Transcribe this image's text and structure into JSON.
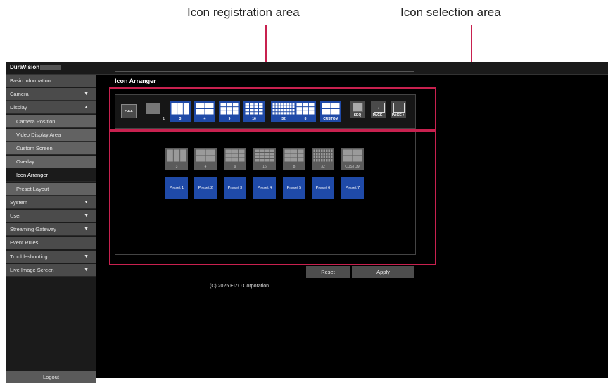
{
  "callouts": {
    "registration": "Icon registration area",
    "selection": "Icon selection area",
    "accent_color": "#c8214f"
  },
  "app": {
    "brand": "DuraVision",
    "page_title": "Icon Arranger",
    "copyright": "(C) 2025 EIZO Corporation"
  },
  "sidebar": {
    "items": [
      {
        "label": "Basic Information",
        "arrow": ""
      },
      {
        "label": "Camera",
        "arrow": "▼"
      },
      {
        "label": "Display",
        "arrow": "▲"
      },
      {
        "label": "Camera Position",
        "arrow": ""
      },
      {
        "label": "Video Display Area",
        "arrow": ""
      },
      {
        "label": "Custom Screen",
        "arrow": ""
      },
      {
        "label": "Overlay",
        "arrow": ""
      },
      {
        "label": "Icon Arranger",
        "arrow": ""
      },
      {
        "label": "Preset Layout",
        "arrow": ""
      },
      {
        "label": "System",
        "arrow": "▼"
      },
      {
        "label": "User",
        "arrow": "▼"
      },
      {
        "label": "Streaming Gateway",
        "arrow": "▼"
      },
      {
        "label": "Event Rules",
        "arrow": ""
      },
      {
        "label": "Troubleshooting",
        "arrow": "▼"
      },
      {
        "label": "Live Image Screen",
        "arrow": "▼"
      }
    ],
    "logout": "Logout"
  },
  "registration_icons": [
    {
      "label": "FULL",
      "name": "full-screen-icon"
    },
    {
      "label": "1",
      "name": "single-view-icon"
    },
    {
      "label": "3",
      "name": "layout-3-icon"
    },
    {
      "label": "4",
      "name": "layout-4-icon"
    },
    {
      "label": "9",
      "name": "layout-9-icon"
    },
    {
      "label": "16",
      "name": "layout-16-icon"
    },
    {
      "label": "32",
      "name": "layout-32-icon"
    },
    {
      "label": "8",
      "name": "layout-8-icon"
    },
    {
      "label": "CUSTOM",
      "name": "layout-custom-icon"
    },
    {
      "label": "SEQ",
      "name": "sequence-icon"
    },
    {
      "label": "PAGE -",
      "name": "page-prev-icon"
    },
    {
      "label": "PAGE +",
      "name": "page-next-icon"
    }
  ],
  "selection_icons": [
    {
      "label": "3",
      "name": "select-layout-3-icon"
    },
    {
      "label": "4",
      "name": "select-layout-4-icon"
    },
    {
      "label": "9",
      "name": "select-layout-9-icon"
    },
    {
      "label": "16",
      "name": "select-layout-16-icon"
    },
    {
      "label": "8",
      "name": "select-layout-8-icon"
    },
    {
      "label": "32",
      "name": "select-layout-32-icon"
    },
    {
      "label": "CUSTOM",
      "name": "select-layout-custom-icon"
    }
  ],
  "presets": [
    "Preset 1",
    "Preset 2",
    "Preset 3",
    "Preset 4",
    "Preset 5",
    "Preset 6",
    "Preset 7"
  ],
  "buttons": {
    "reset": "Reset",
    "apply": "Apply"
  }
}
